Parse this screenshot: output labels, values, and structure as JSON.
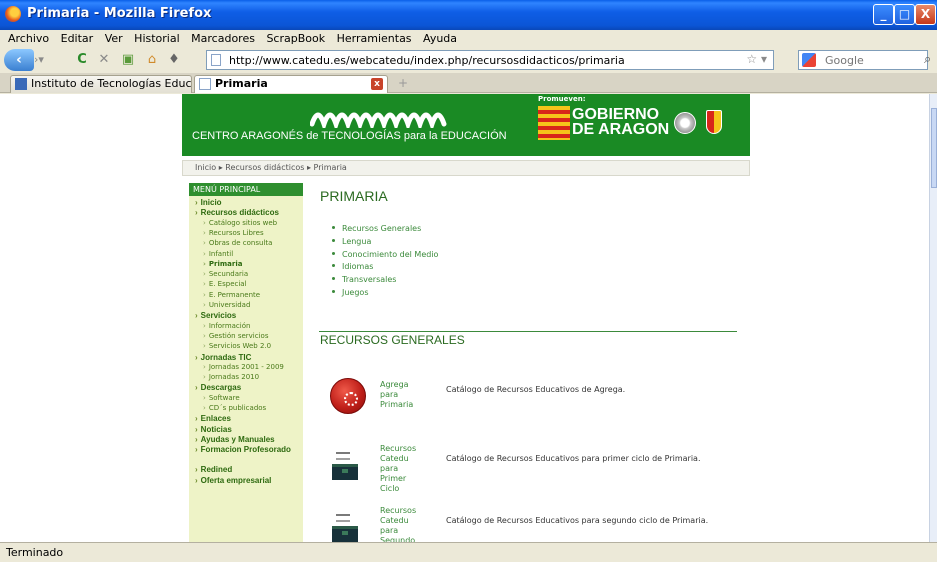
{
  "window": {
    "title": "Primaria - Mozilla Firefox",
    "buttons": {
      "minimize": "_",
      "maximize": "□",
      "close": "X"
    }
  },
  "menu": [
    "Archivo",
    "Editar",
    "Ver",
    "Historial",
    "Marcadores",
    "ScrapBook",
    "Herramientas",
    "Ayuda"
  ],
  "nav": {
    "url": "http://www.catedu.es/webcatedu/index.php/recursosdidacticos/primaria",
    "search_placeholder": "Google"
  },
  "tabs": [
    {
      "label": "Instituto de Tecnologías Educa...",
      "active": false
    },
    {
      "label": "Primaria",
      "active": true
    }
  ],
  "status": "Terminado",
  "banner": {
    "center_name": "CENTRO ARAGONÉS de TECNOLOGÍAS para la EDUCACIÓN",
    "promueven": "Promueven:",
    "gobierno_line1": "GOBIERNO",
    "gobierno_line2": "DE ARAGON"
  },
  "breadcrumb": "Inicio ▸ Recursos didácticos ▸ Primaria",
  "sidebar": {
    "heading": "MENÚ PRINCIPAL",
    "items": [
      {
        "label": "Inicio",
        "level": 1
      },
      {
        "label": "Recursos didácticos",
        "level": 1
      },
      {
        "label": "Catálogo sitios web",
        "level": 2
      },
      {
        "label": "Recursos Libres",
        "level": 2
      },
      {
        "label": "Obras de consulta",
        "level": 2
      },
      {
        "label": "Infantil",
        "level": 2
      },
      {
        "label": "Primaria",
        "level": 2,
        "active": true
      },
      {
        "label": "Secundaria",
        "level": 2
      },
      {
        "label": "E. Especial",
        "level": 2
      },
      {
        "label": "E. Permanente",
        "level": 2
      },
      {
        "label": "Universidad",
        "level": 2
      },
      {
        "label": "Servicios",
        "level": 1
      },
      {
        "label": "Información",
        "level": 2
      },
      {
        "label": "Gestión servicios",
        "level": 2
      },
      {
        "label": "Servicios Web 2.0",
        "level": 2
      },
      {
        "label": "Jornadas TIC",
        "level": 1
      },
      {
        "label": "Jornadas 2001 - 2009",
        "level": 2
      },
      {
        "label": "Jornadas 2010",
        "level": 2
      },
      {
        "label": "Descargas",
        "level": 1
      },
      {
        "label": "Software",
        "level": 2
      },
      {
        "label": "CD´s publicados",
        "level": 2
      },
      {
        "label": "Enlaces",
        "level": 1
      },
      {
        "label": "Noticias",
        "level": 1
      },
      {
        "label": "Ayudas y Manuales",
        "level": 1
      },
      {
        "label": "Formacion Profesorado",
        "level": 1
      },
      {
        "label": "Redined",
        "level": 1
      },
      {
        "label": "Oferta empresarial",
        "level": 1
      }
    ]
  },
  "main": {
    "title": "PRIMARIA",
    "anchors": [
      "Recursos Generales",
      "Lengua",
      "Conocimiento del Medio",
      "Idiomas",
      "Transversales",
      "Juegos"
    ],
    "section_title": "RECURSOS GENERALES",
    "resources": [
      {
        "icon": "agrega-icon",
        "link": "Agrega para\nPrimaria",
        "desc": "Catálogo de Recursos Educativos de Agrega."
      },
      {
        "icon": "toolbox-icon",
        "link": "Recursos\nCatedu para\nPrimer Ciclo",
        "desc": "Catálogo de Recursos Educativos para primer ciclo de Primaria."
      },
      {
        "icon": "toolbox-icon",
        "link": "Recursos\nCatedu para\nSegundo Ciclo",
        "desc": "Catálogo de Recursos Educativos para segundo ciclo de Primaria."
      }
    ]
  }
}
